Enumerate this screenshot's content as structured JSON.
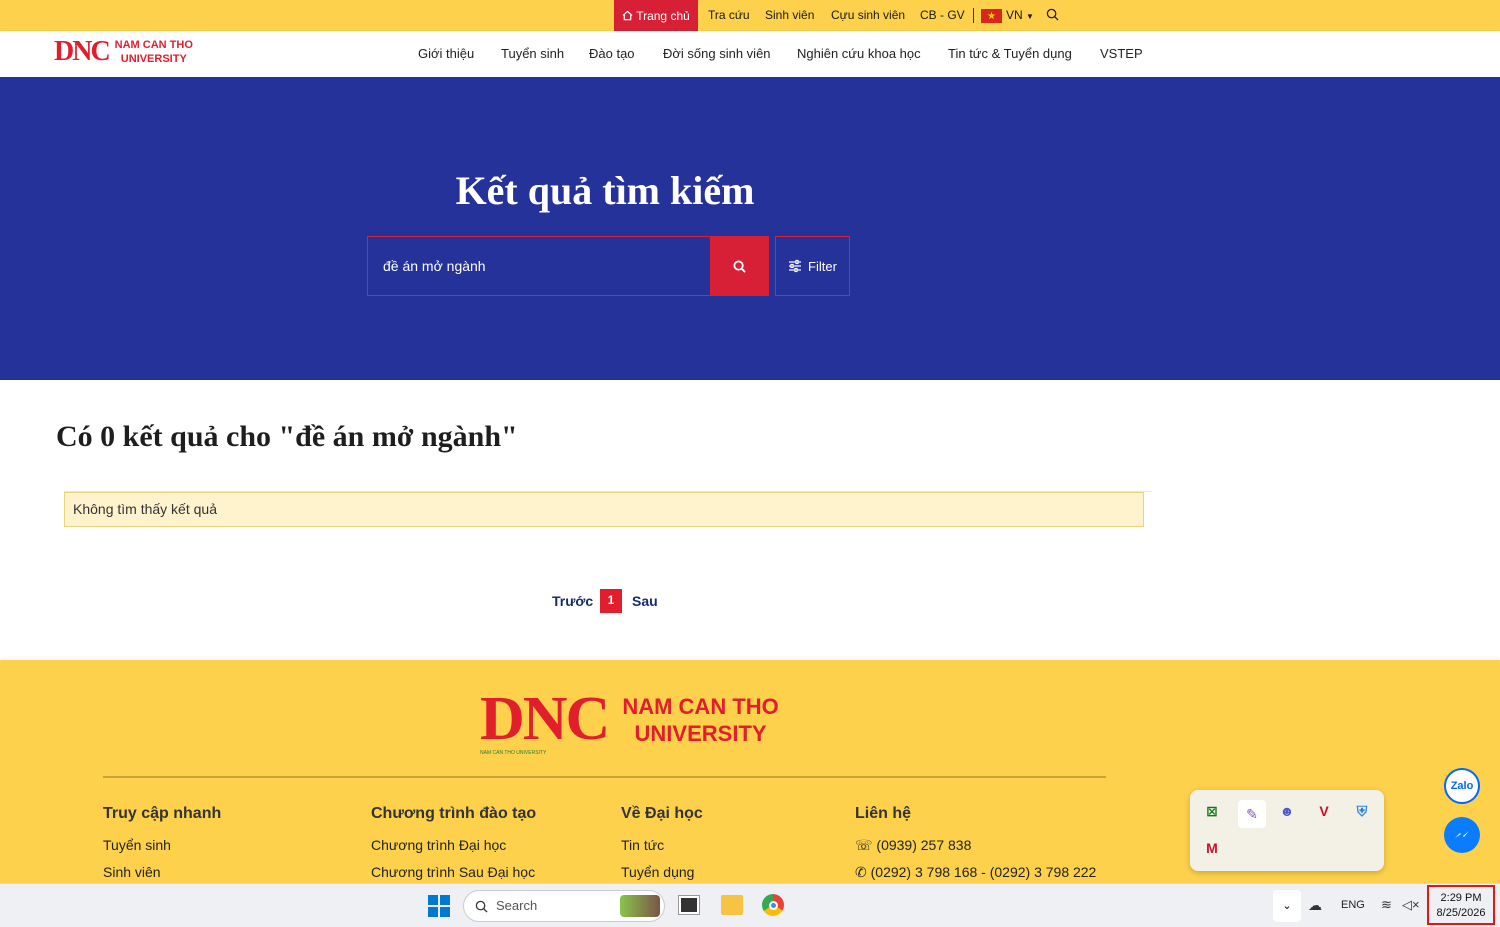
{
  "topbar": {
    "home": "Trang chủ",
    "links": [
      "Tra cứu",
      "Sinh viên",
      "Cựu sinh viên",
      "CB - GV"
    ],
    "lang": "VN"
  },
  "logo": {
    "line1": "NAM CAN THO",
    "line2": "UNIVERSITY",
    "mark": "DNC",
    "tagline": "NAM CAN THO UNIVERSITY"
  },
  "nav": [
    "Giới thiệu",
    "Tuyển sinh",
    "Đào tạo",
    "Đời sống sinh viên",
    "Nghiên cứu khoa học",
    "Tin tức & Tuyển dụng",
    "VSTEP"
  ],
  "hero": {
    "title": "Kết quả tìm kiếm",
    "query": "đề án mở ngành",
    "filter": "Filter"
  },
  "results": {
    "heading": "Có 0 kết quả cho \"đề án mở ngành\"",
    "empty": "Không tìm thấy kết quả"
  },
  "pagination": {
    "prev": "Trước",
    "current": "1",
    "next": "Sau"
  },
  "footer": {
    "cols": [
      {
        "title": "Truy cập nhanh",
        "items": [
          "Tuyển sinh",
          "Sinh viên"
        ]
      },
      {
        "title": "Chương trình đào tạo",
        "items": [
          "Chương trình Đại học",
          "Chương trình Sau Đại học"
        ]
      },
      {
        "title": "Về Đại học",
        "items": [
          "Tin tức",
          "Tuyển dụng"
        ]
      },
      {
        "title": "Liên hệ",
        "items": [
          "(0939) 257 838",
          "(0292) 3 798 168 - (0292) 3 798 222"
        ]
      }
    ]
  },
  "taskbar": {
    "search": "Search",
    "lang": "ENG",
    "time": "2:29 PM",
    "date": "8/25/2026"
  },
  "colors": {
    "primary_blue": "#24329a",
    "accent_red": "#d71f36",
    "brand_yellow": "#fdd14c"
  }
}
